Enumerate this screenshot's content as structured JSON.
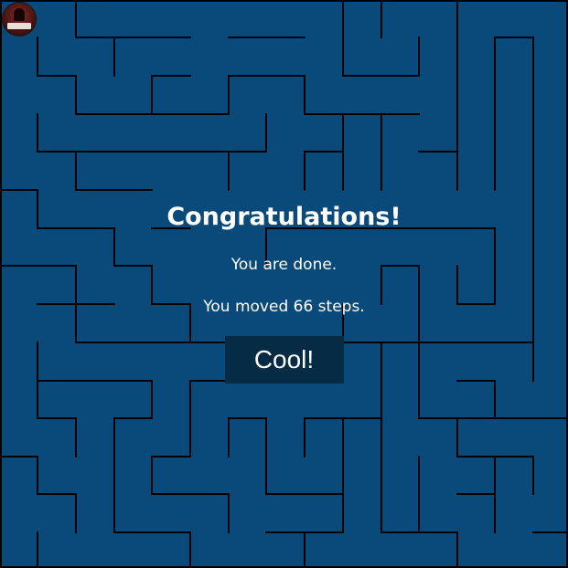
{
  "user": {
    "avatar_icon": "player-avatar-icon"
  },
  "dialog": {
    "title": "Congratulations!",
    "message_done": "You are done.",
    "message_steps": "You moved 66 steps.",
    "button_label": "Cool!"
  },
  "colors": {
    "background": "#0a4a7a",
    "walls": "#000000",
    "button": "#052b45",
    "text": "#ffffff"
  }
}
